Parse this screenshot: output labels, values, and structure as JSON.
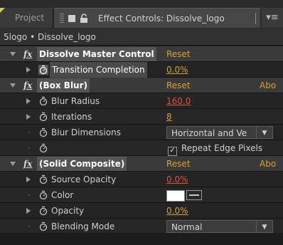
{
  "tabs": {
    "project_label": "Project",
    "effect_controls_label": "Effect Controls: Dissolve_logo",
    "panel_menu_glyph": "▾≡"
  },
  "breadcrumb": "5logo • Dissolve_logo",
  "colors": {
    "reset_link": "#d6a22e",
    "keyframed_value": "#e0523a",
    "value": "#d6a22e",
    "effect_row_bg": "#3a3a3a"
  },
  "effects": [
    {
      "name": "Dissolve Master Control",
      "reset": "Reset",
      "about": "",
      "properties": [
        {
          "label": "Transition Completion",
          "value": "0.0%",
          "value_style": "orange",
          "keyframed": true,
          "selected": true
        }
      ]
    },
    {
      "name": "(Box Blur)",
      "reset": "Reset",
      "about": "Abo",
      "properties": [
        {
          "label": "Blur Radius",
          "value": "160.0",
          "value_style": "red"
        },
        {
          "label": "Iterations",
          "value": "8",
          "value_style": "orange"
        },
        {
          "label": "Blur Dimensions",
          "dropdown": "Horizontal and Ve",
          "dropdown_arrow": "▼"
        },
        {
          "label": "",
          "checkbox_label": "Repeat Edge Pixels",
          "checked": true,
          "check_glyph": "✓"
        }
      ]
    },
    {
      "name": "(Solid Composite)",
      "reset": "Reset",
      "about": "Abo",
      "properties": [
        {
          "label": "Source Opacity",
          "value": "0.0%",
          "value_style": "red"
        },
        {
          "label": "Color",
          "color_swatch": "#ffffff"
        },
        {
          "label": "Opacity",
          "value": "0.0%",
          "value_style": "orange"
        },
        {
          "label": "Blending Mode",
          "dropdown": "Normal",
          "dropdown_arrow": "▼"
        }
      ]
    }
  ]
}
